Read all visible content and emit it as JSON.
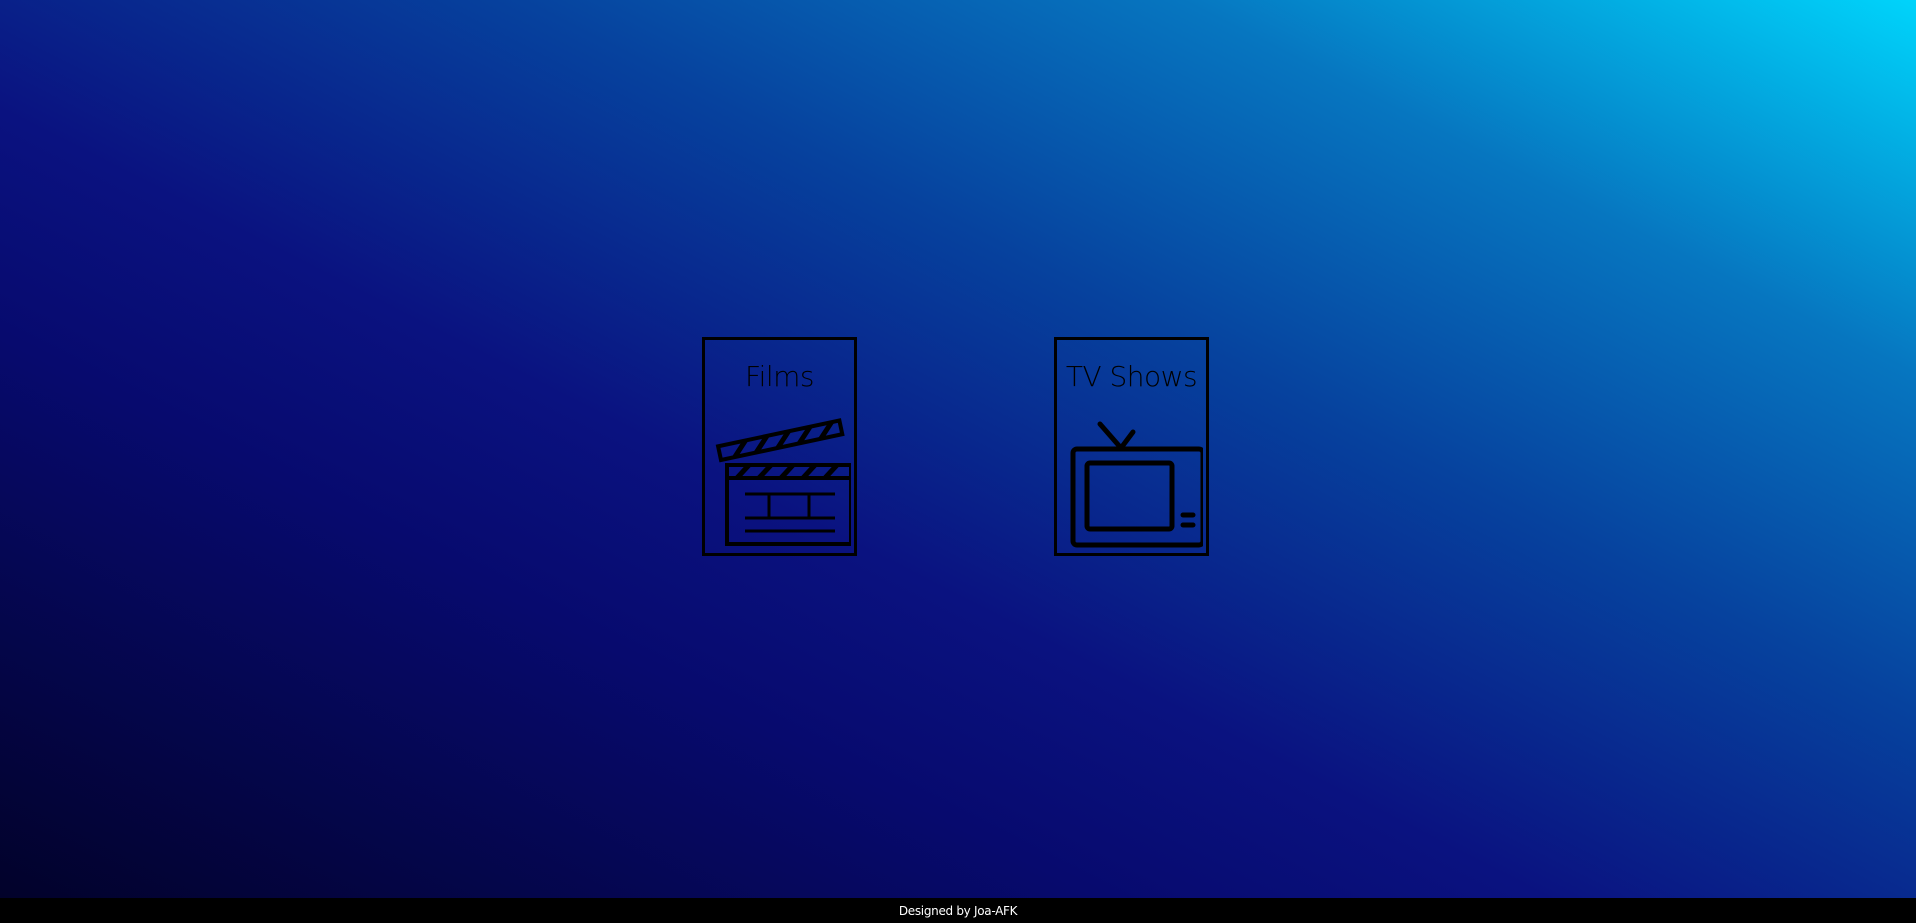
{
  "cards": [
    {
      "label": "Films",
      "icon": "clapperboard-icon"
    },
    {
      "label": "TV Shows",
      "icon": "television-icon"
    }
  ],
  "footer": {
    "text": "Designed by Joa-AFK"
  },
  "colors": {
    "gradient_dark": "#02022a",
    "gradient_mid": "#0a1280",
    "gradient_light": "#00d4fb",
    "outline": "#000000",
    "footer_bg": "#000000",
    "footer_text": "#ffffff"
  }
}
